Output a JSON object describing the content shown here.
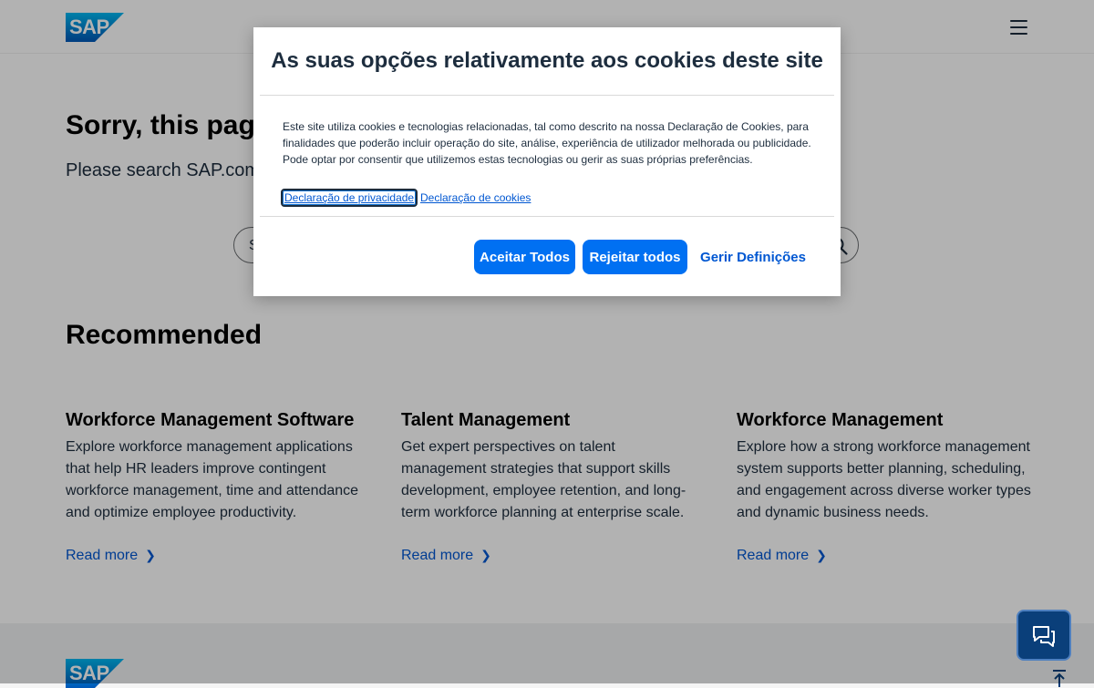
{
  "header": {
    "logo_text": "SAP",
    "menu_icon": "hamburger-menu-icon"
  },
  "main": {
    "error_title": "Sorry, this page c",
    "error_subtitle": "Please search SAP.com",
    "search": {
      "value": "S",
      "icon": "search-icon"
    },
    "recommended_title": "Recommended",
    "cards": [
      {
        "title": "Workforce Management Software",
        "description": "Explore workforce management applications that help HR leaders improve contingent workforce management, time and attendance and optimize employee productivity.",
        "link": "Read more"
      },
      {
        "title": "Talent Management",
        "description": "Get expert perspectives on talent management strategies that support skills development, employee retention, and long-term workforce planning at enterprise scale.",
        "link": "Read more"
      },
      {
        "title": "Workforce Management",
        "description": "Explore how a strong workforce management system supports better planning, scheduling, and engagement across diverse worker types and dynamic business needs.",
        "link": "Read more"
      }
    ]
  },
  "footer": {
    "logo_text": "SAP",
    "back_to_top_icon": "arrow-up-icon"
  },
  "cookie_modal": {
    "title": "As suas opções relativamente aos cookies deste site",
    "text": "Este site utiliza cookies e tecnologias relacionadas, tal como descrito na nossa Declaração de Cookies, para finalidades que poderão incluir operação do site, análise, experiência de utilizador melhorada ou publicidade. Pode optar por consentir que utilizemos estas tecnologias ou gerir as suas próprias preferências.",
    "privacy_link": "Declaração de privacidade",
    "cookies_link": "Declaração de cookies",
    "accept_all": "Aceitar Todos",
    "reject_all": "Rejeitar todos",
    "manage_settings": "Gerir Definições"
  },
  "chat": {
    "icon": "chat-bubbles-icon"
  },
  "colors": {
    "brand_blue": "#0070f2",
    "link_blue": "#0057d2",
    "text_dark": "#1d2d3e",
    "chat_bg": "#0a3f7a"
  }
}
